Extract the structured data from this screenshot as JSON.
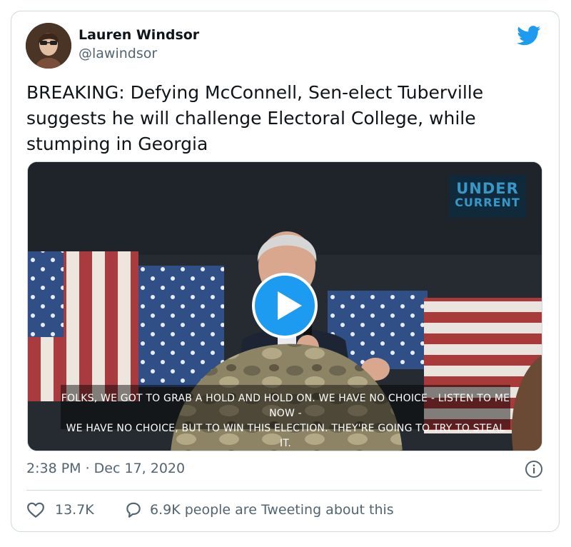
{
  "author": {
    "name": "Lauren Windsor",
    "handle": "@lawindsor",
    "avatar_icon": "profile-photo"
  },
  "tweet": {
    "text": "BREAKING: Defying McConnell, Sen-elect Tuberville suggests he will challenge Electoral College, while stumping in Georgia"
  },
  "media": {
    "watermark_line1": "UNDER",
    "watermark_line2": "CURRENT",
    "caption_line1": "FOLKS, WE GOT TO GRAB A HOLD AND HOLD ON. WE HAVE NO CHOICE - LISTEN TO ME NOW -",
    "caption_line2": "WE HAVE NO CHOICE, BUT TO WIN THIS ELECTION. THEY'RE GOING TO TRY TO STEAL IT.",
    "play_icon": "play-icon"
  },
  "meta": {
    "timestamp": "2:38 PM · Dec 17, 2020",
    "info_icon": "info-icon"
  },
  "stats": {
    "likes": "13.7K",
    "conversation": "6.9K people are Tweeting about this"
  },
  "colors": {
    "brand": "#1d9bf0",
    "text_primary": "#0f1419",
    "text_secondary": "#536471",
    "border": "#cfd9de"
  }
}
